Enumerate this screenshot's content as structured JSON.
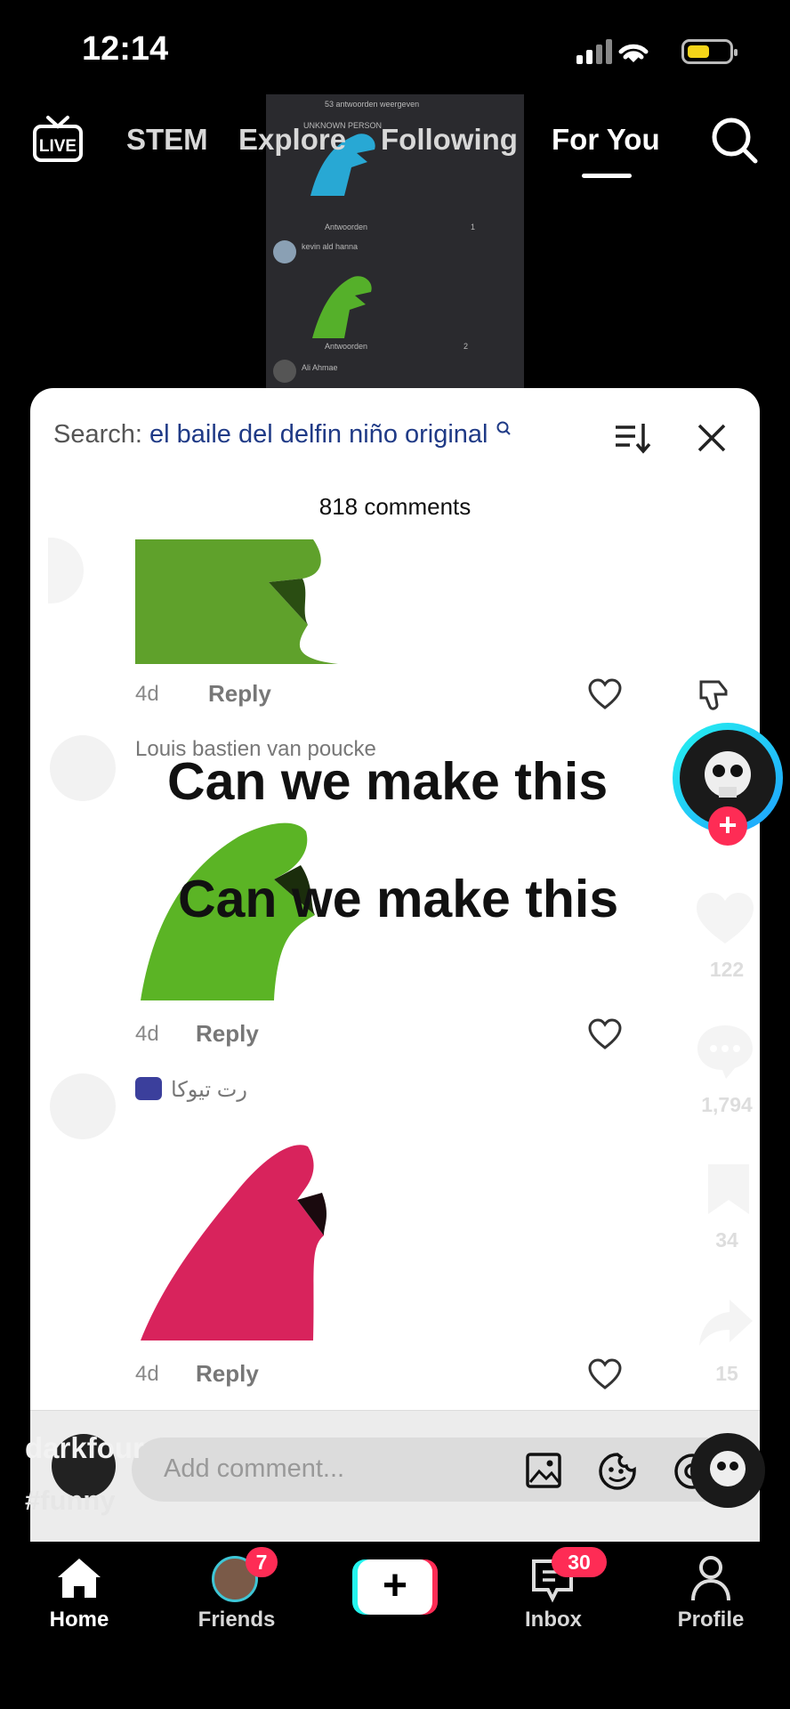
{
  "status_bar": {
    "time": "12:14",
    "battery_color": "#f4d418"
  },
  "top_nav": {
    "tabs": [
      {
        "label": "STEM"
      },
      {
        "label": "Explore"
      },
      {
        "label": "Following"
      },
      {
        "label": "For You",
        "active": true
      }
    ]
  },
  "video_thumb": {
    "line1": "53 antwoorden weergeven",
    "line2": "UNKNOWN PERSON",
    "reply_a": "Antwoorden",
    "like_a": "1",
    "user_b": "kevin ald hanna",
    "reply_b": "Antwoorden",
    "like_b": "2",
    "user_c": "Ali Ahmae"
  },
  "comments_sheet": {
    "search_prefix": "Search:",
    "search_query": "el baile del delfin niño original",
    "count_label": "818 comments",
    "comments": [
      {
        "meta": "4d",
        "reply_label": "Reply",
        "image_color": "#5fa12b"
      },
      {
        "username": "Louis bastien van poucke",
        "meta": "4d",
        "reply_label": "Reply",
        "image_color": "#5bb425"
      },
      {
        "username": "رت تیوکا",
        "meta": "4d",
        "reply_label": "Reply",
        "image_color": "#d8235c"
      }
    ],
    "overlay_text_1": "Can we make this",
    "overlay_text_2": "Can we make this",
    "add_comment_placeholder": "Add comment..."
  },
  "right_rail": {
    "likes": "122",
    "comments": "1,794",
    "saves": "34",
    "shares": "15"
  },
  "video_caption": {
    "author": "darkfour",
    "hashtag": "#funny"
  },
  "bottom_nav": {
    "home": "Home",
    "friends": "Friends",
    "friends_badge": "7",
    "inbox": "Inbox",
    "inbox_badge": "30",
    "profile": "Profile",
    "accent_red": "#fe2c55",
    "accent_cyan": "#25f4ee"
  }
}
